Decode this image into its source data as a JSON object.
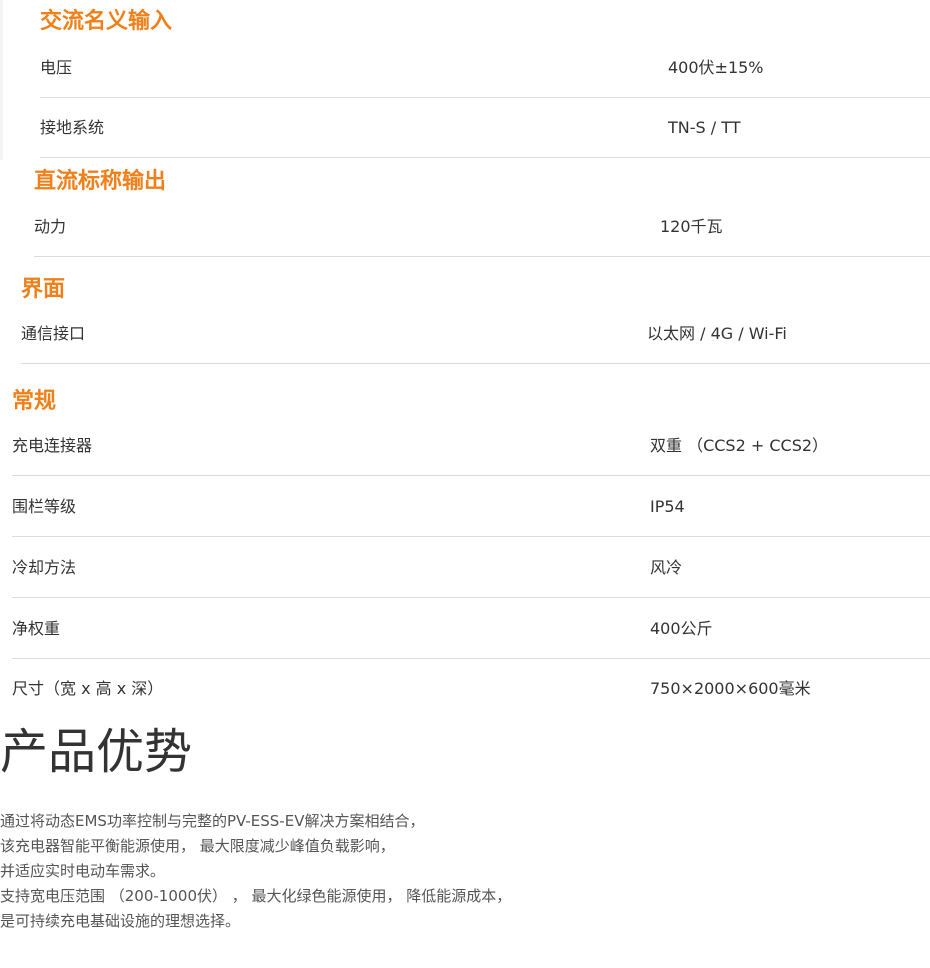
{
  "sections": {
    "ac_input": {
      "title": "交流名义输入",
      "rows": [
        {
          "label": "电压",
          "value": "400伏±15%"
        },
        {
          "label": "接地系统",
          "value": "TN-S / TT"
        }
      ]
    },
    "dc_output": {
      "title": "直流标称输出",
      "rows": [
        {
          "label": "动力",
          "value": "120千瓦"
        }
      ]
    },
    "interface": {
      "title": "界面",
      "rows": [
        {
          "label": "通信接口",
          "value": "以太网 / 4G / Wi-Fi"
        }
      ]
    },
    "general": {
      "title": "常规",
      "rows": [
        {
          "label": "充电连接器",
          "value": "双重 （CCS2 + CCS2）"
        },
        {
          "label": "围栏等级",
          "value": "IP54"
        },
        {
          "label": "冷却方法",
          "value": "风冷"
        },
        {
          "label": "净权重",
          "value": "400公斤"
        },
        {
          "label": "尺寸（宽 x 高 x 深）",
          "value": "750×2000×600毫米"
        }
      ]
    }
  },
  "advantages": {
    "title": "产品优势",
    "lines": [
      "通过将动态EMS功率控制与完整的PV-ESS-EV解决方案相结合，",
      "该充电器智能平衡能源使用， 最大限度减少峰值负载影响，",
      "并适应实时电动车需求。",
      "支持宽电压范围 （200-1000伏） ， 最大化绿色能源使用， 降低能源成本，",
      "是可持续充电基础设施的理想选择。"
    ]
  },
  "colors": {
    "accent": "#f08019",
    "text": "#333333",
    "divider": "#dcdcdc"
  }
}
